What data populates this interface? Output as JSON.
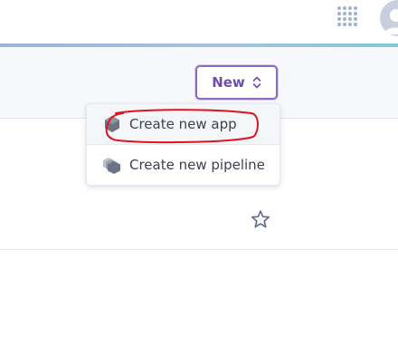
{
  "header": {
    "apps_icon": "grid-dots-icon",
    "avatar_icon": "user-avatar-icon"
  },
  "toolbar": {
    "new_label": "New",
    "new_icon": "chevron-up-down-icon"
  },
  "new_menu": {
    "items": [
      {
        "label": "Create new app",
        "icon": "hexagon-app-icon"
      },
      {
        "label": "Create new pipeline",
        "icon": "stacked-hexagons-pipeline-icon"
      }
    ]
  },
  "list": {
    "favorite_icon": "star-outline-icon"
  },
  "colors": {
    "accent": "#6f4ea8",
    "button_border": "#8a6bbd",
    "annotation": "#e0141b"
  }
}
